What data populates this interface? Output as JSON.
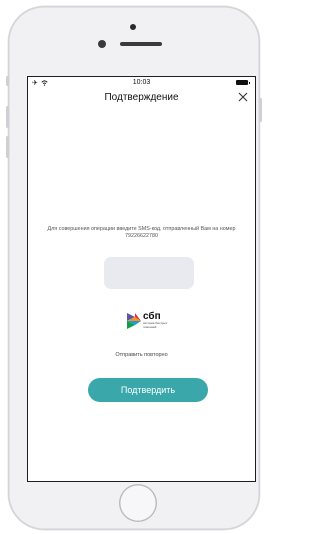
{
  "status_bar": {
    "time": "10:03"
  },
  "header": {
    "title": "Подтверждение",
    "close_icon": "close-icon"
  },
  "message": "Для совершения операции введите SMS-код, отправленный Вам на номер 79226622780",
  "code_input": {
    "value": "",
    "placeholder": ""
  },
  "sbp": {
    "name": "сбп",
    "subtitle": "система быстрых платежей"
  },
  "resend_label": "Отправить повторно",
  "confirm_label": "Подтвердить",
  "colors": {
    "accent": "#3aa8ab",
    "input_bg": "#e9eaef"
  }
}
